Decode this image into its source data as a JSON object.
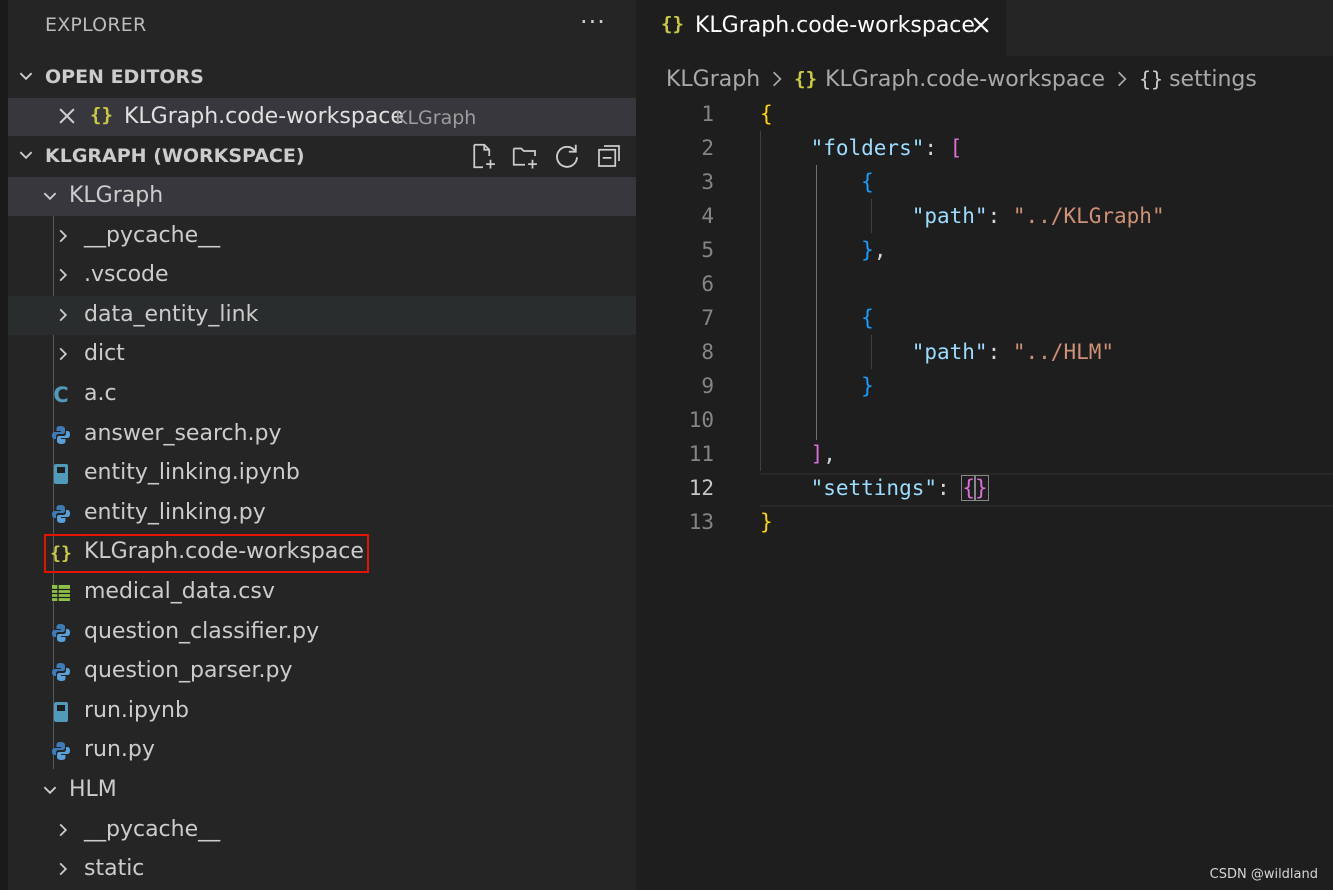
{
  "explorer": {
    "title": "EXPLORER",
    "more_label": "···",
    "open_editors": {
      "header": "OPEN EDITORS",
      "items": [
        {
          "icon": "{}",
          "name": "KLGraph.code-workspace",
          "description": "KLGraph"
        }
      ]
    },
    "workspace": {
      "header": "KLGRAPH (WORKSPACE)",
      "folders": [
        {
          "name": "KLGraph",
          "expanded": true,
          "children": [
            {
              "name": "__pycache__",
              "type": "folder",
              "icon": "chevron-right-icon"
            },
            {
              "name": ".vscode",
              "type": "folder",
              "icon": "chevron-right-icon"
            },
            {
              "name": "data_entity_link",
              "type": "folder",
              "icon": "chevron-right-icon"
            },
            {
              "name": "dict",
              "type": "folder",
              "icon": "chevron-right-icon"
            },
            {
              "name": "a.c",
              "type": "file",
              "icon": "c-file-icon",
              "icon_glyph": "C"
            },
            {
              "name": "answer_search.py",
              "type": "file",
              "icon": "python-icon"
            },
            {
              "name": "entity_linking.ipynb",
              "type": "file",
              "icon": "notebook-icon"
            },
            {
              "name": "entity_linking.py",
              "type": "file",
              "icon": "python-icon"
            },
            {
              "name": "KLGraph.code-workspace",
              "type": "file",
              "icon": "json-braces-icon",
              "icon_glyph": "{}"
            },
            {
              "name": "medical_data.csv",
              "type": "file",
              "icon": "csv-table-icon"
            },
            {
              "name": "question_classifier.py",
              "type": "file",
              "icon": "python-icon"
            },
            {
              "name": "question_parser.py",
              "type": "file",
              "icon": "python-icon"
            },
            {
              "name": "run.ipynb",
              "type": "file",
              "icon": "notebook-icon"
            },
            {
              "name": "run.py",
              "type": "file",
              "icon": "python-icon"
            }
          ]
        },
        {
          "name": "HLM",
          "expanded": true,
          "children": [
            {
              "name": "__pycache__",
              "type": "folder",
              "icon": "chevron-right-icon"
            },
            {
              "name": "static",
              "type": "folder",
              "icon": "chevron-right-icon"
            }
          ]
        }
      ]
    }
  },
  "editor": {
    "tab": {
      "icon": "{}",
      "label": "KLGraph.code-workspace"
    },
    "breadcrumb": [
      {
        "label": "KLGraph"
      },
      {
        "icon": "{}",
        "label": "KLGraph.code-workspace"
      },
      {
        "icon": "{}",
        "label": "settings"
      }
    ],
    "active_line": 12,
    "lines": [
      {
        "n": "1",
        "text": "{"
      },
      {
        "n": "2",
        "text": "    \"folders\": ["
      },
      {
        "n": "3",
        "text": "        {"
      },
      {
        "n": "4",
        "text": "            \"path\": \"../KLGraph\""
      },
      {
        "n": "5",
        "text": "        },"
      },
      {
        "n": "6",
        "text": ""
      },
      {
        "n": "7",
        "text": "        {"
      },
      {
        "n": "8",
        "text": "            \"path\": \"../HLM\""
      },
      {
        "n": "9",
        "text": "        }"
      },
      {
        "n": "10",
        "text": ""
      },
      {
        "n": "11",
        "text": "    ],"
      },
      {
        "n": "12",
        "text": "    \"settings\": {}"
      },
      {
        "n": "13",
        "text": "}"
      }
    ]
  },
  "watermark": "CSDN @wildland",
  "colors": {
    "sidebar_bg": "#252526",
    "editor_bg": "#1e1e1e",
    "selection_bg": "#37373d",
    "highlight_border": "#e51400",
    "json_key": "#9cdcfe",
    "json_string": "#ce9178",
    "bracket_level1": "#ffd700",
    "bracket_level2": "#da70d6",
    "bracket_level3": "#179fff",
    "workspace_icon": "#cbcb41"
  }
}
